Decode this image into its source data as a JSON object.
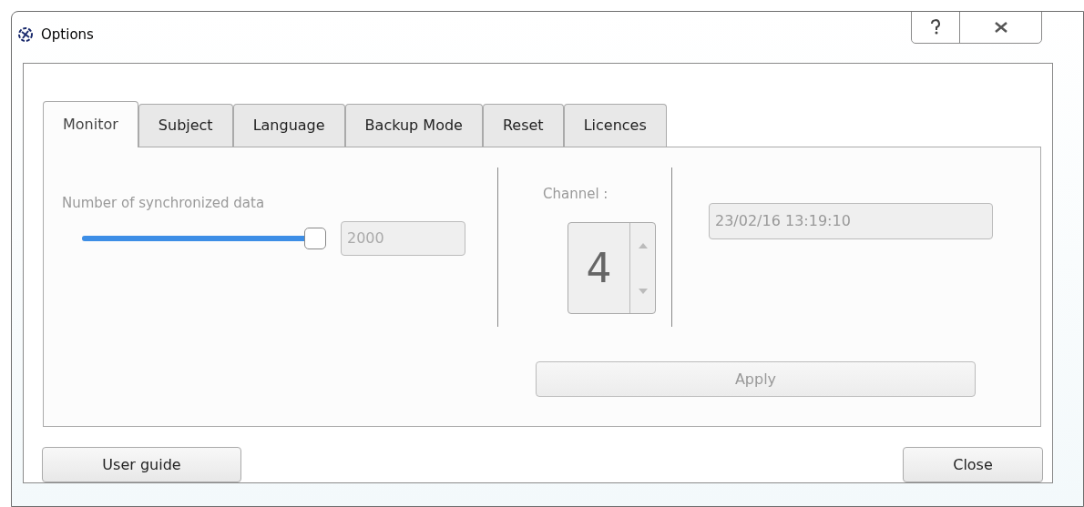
{
  "window": {
    "title": "Options"
  },
  "tabs": [
    {
      "label": "Monitor",
      "selected": true
    },
    {
      "label": "Subject",
      "selected": false
    },
    {
      "label": "Language",
      "selected": false
    },
    {
      "label": "Backup Mode",
      "selected": false
    },
    {
      "label": "Reset",
      "selected": false
    },
    {
      "label": "Licences",
      "selected": false
    }
  ],
  "monitor": {
    "sync_label": "Number of synchronized data",
    "slider": {
      "level": 1.0
    },
    "sync_value": "2000",
    "channel_label": "Channel :",
    "channel_value": "4",
    "timestamp": "23/02/16 13:19:10",
    "apply": {
      "label": "Apply",
      "disabled": true
    }
  },
  "buttons": [
    {
      "label": "User guide"
    },
    {
      "label": "Close"
    }
  ]
}
